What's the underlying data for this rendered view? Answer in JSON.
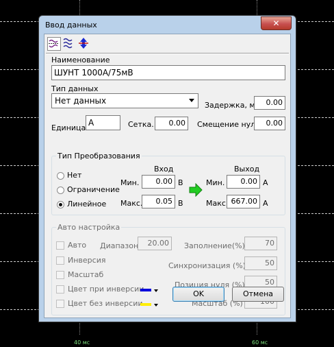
{
  "window": {
    "title": "Ввод данных",
    "close_label": "✕"
  },
  "toolbar": {
    "icons": [
      "wave-flip-icon",
      "wave-stack-icon",
      "vertical-arrows-icon"
    ]
  },
  "name": {
    "label": "Наименование",
    "value": "ШУНТ 1000А/75мВ"
  },
  "data_type": {
    "label": "Тип данных",
    "value": "Нет данных"
  },
  "delay": {
    "label": "Задержка, мс",
    "value": "0.00"
  },
  "unit": {
    "label": "Единица..",
    "value": "А"
  },
  "grid": {
    "label": "Сетка..",
    "value": "0.00"
  },
  "zero_offset": {
    "label": "Смещение нуля",
    "value": "0.00"
  },
  "conversion": {
    "title": "Тип Преобразования",
    "options": [
      {
        "label": "Нет",
        "checked": false
      },
      {
        "label": "Ограничение",
        "checked": false
      },
      {
        "label": "Линейное",
        "checked": true
      }
    ],
    "input_header": "Вход",
    "output_header": "Выход",
    "min_label": "Мин.",
    "max_label": "Макс.",
    "in_min": "0.00",
    "in_max": "0.05",
    "in_unit": "В",
    "out_min": "0.00",
    "out_max": "667.00",
    "out_unit": "А",
    "arrow_color": "#22cc22"
  },
  "auto": {
    "title": "Авто настройка",
    "checks": [
      "Авто",
      "Инверсия",
      "Масштаб",
      "Цвет при инверсии",
      "Цвет без инверсии"
    ],
    "inverse_color": "#0000dd",
    "normal_color": "#ffee00",
    "range_label": "Диапазон..",
    "range_value": "20.00",
    "fill_label": "Заполнение(%)",
    "fill_value": "70",
    "sync_label": "Синхронизация (%)",
    "sync_value": "50",
    "zero_pos_label": "Позиция нуля (%)",
    "zero_pos_value": "50",
    "scale_label": "Масштаб (%)",
    "scale_value": "100"
  },
  "buttons": {
    "ok": "OK",
    "cancel": "Отмена"
  },
  "background": {
    "axis_labels": [
      "40 мс",
      "60 мс"
    ],
    "axis_color": "#7de07d"
  }
}
